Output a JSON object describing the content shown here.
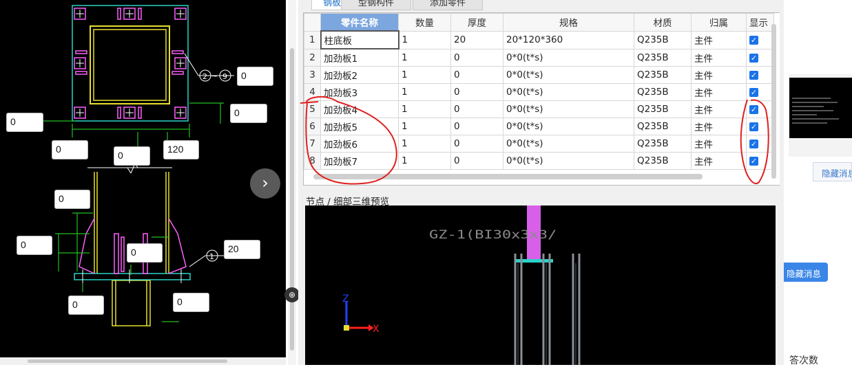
{
  "cad": {
    "dims": {
      "d_right_top": "0",
      "d_right_mid": "0",
      "d_left_mid": "0",
      "d_bottom_a": "0",
      "d_bottom_b": "0",
      "d_bottom_c": "120",
      "d_elev_a": "0",
      "d_elev_b": "0",
      "d_elev_c": "0",
      "d_elev_thick": "20",
      "d_elev_d": "0",
      "d_elev_e": "0"
    },
    "callouts": {
      "range": "②~⑨",
      "one": "①"
    },
    "next_arrow": "›",
    "image_icon": "⊕"
  },
  "tabs": [
    "钢板",
    "型钢构件",
    "添加零件"
  ],
  "grid": {
    "headers": [
      "零件名称",
      "数量",
      "厚度",
      "规格",
      "材质",
      "归属",
      "显示"
    ],
    "rows": [
      {
        "n": "1",
        "name": "柱底板",
        "qty": "1",
        "thick": "20",
        "spec": "20*120*360",
        "mat": "Q235B",
        "owner": "主件",
        "show": "✓"
      },
      {
        "n": "2",
        "name": "加劲板1",
        "qty": "1",
        "thick": "0",
        "spec": "0*0(t*s)",
        "mat": "Q235B",
        "owner": "主件",
        "show": "✓"
      },
      {
        "n": "3",
        "name": "加劲板2",
        "qty": "1",
        "thick": "0",
        "spec": "0*0(t*s)",
        "mat": "Q235B",
        "owner": "主件",
        "show": "✓"
      },
      {
        "n": "4",
        "name": "加劲板3",
        "qty": "1",
        "thick": "0",
        "spec": "0*0(t*s)",
        "mat": "Q235B",
        "owner": "主件",
        "show": "✓"
      },
      {
        "n": "5",
        "name": "加劲板4",
        "qty": "1",
        "thick": "0",
        "spec": "0*0(t*s)",
        "mat": "Q235B",
        "owner": "主件",
        "show": "✓"
      },
      {
        "n": "6",
        "name": "加劲板5",
        "qty": "1",
        "thick": "0",
        "spec": "0*0(t*s)",
        "mat": "Q235B",
        "owner": "主件",
        "show": "✓"
      },
      {
        "n": "7",
        "name": "加劲板6",
        "qty": "1",
        "thick": "0",
        "spec": "0*0(t*s)",
        "mat": "Q235B",
        "owner": "主件",
        "show": "✓"
      },
      {
        "n": "8",
        "name": "加劲板7",
        "qty": "1",
        "thick": "0",
        "spec": "0*0(t*s)",
        "mat": "Q235B",
        "owner": "主件",
        "show": "✓"
      }
    ]
  },
  "preview": {
    "label": "节点 / 细部三维预览",
    "model_text": "GZ-1(BI30x3x3/",
    "axis_z": "Z",
    "axis_x": "X"
  },
  "right": {
    "hide_msg": "隐藏消息",
    "hide_msg_btn": "隐藏消息",
    "answer_count": "答次数"
  },
  "colors": {
    "cad_bg": "#000000",
    "accent_blue": "#1a73e8",
    "selected_header": "#7ba6de",
    "annotation_red": "#e02020"
  }
}
